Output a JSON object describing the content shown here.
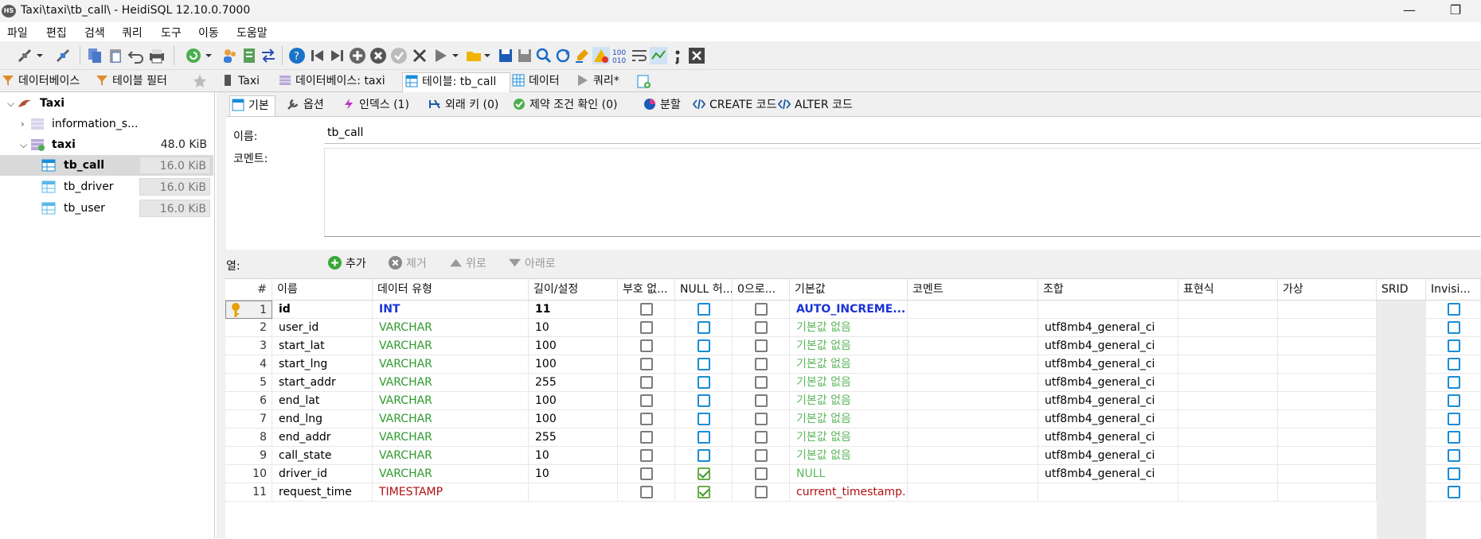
{
  "window": {
    "title": "Taxi\\taxi\\tb_call\\ - HeidiSQL 12.10.0.7000",
    "app_icon": "HS",
    "minimize": "—",
    "restore": "❐"
  },
  "menu": [
    "파일",
    "편집",
    "검색",
    "쿼리",
    "도구",
    "이동",
    "도움말"
  ],
  "main_tabs": {
    "db_tab": "데이터베이스",
    "filter_tab": "테이블 필터",
    "host": "Taxi",
    "database": "데이터베이스: taxi",
    "table": "테이블: tb_call",
    "data": "데이터",
    "query": "쿼리*"
  },
  "tree": {
    "root": "Taxi",
    "items": [
      {
        "name": "information_s...",
        "size": ""
      },
      {
        "name": "taxi",
        "size": "48.0 KiB"
      },
      {
        "name": "tb_call",
        "size": "16.0 KiB"
      },
      {
        "name": "tb_driver",
        "size": "16.0 KiB"
      },
      {
        "name": "tb_user",
        "size": "16.0 KiB"
      }
    ]
  },
  "sub_tabs": [
    "기본",
    "옵션",
    "인덱스 (1)",
    "외래 키 (0)",
    "제약 조건 확인 (0)",
    "분할",
    "CREATE 코드",
    "ALTER 코드"
  ],
  "form": {
    "name_label": "이름:",
    "name_value": "tb_call",
    "comment_label": "코멘트:"
  },
  "columns_toolbar": {
    "label": "열:",
    "add": "추가",
    "remove": "제거",
    "up": "위로",
    "down": "아래로"
  },
  "grid": {
    "headers": [
      "#",
      "이름",
      "데이터 유형",
      "길이/설정",
      "부호 없...",
      "NULL 허...",
      "0으로...",
      "기본값",
      "코멘트",
      "조합",
      "표현식",
      "가상",
      "SRID",
      "Invisi..."
    ],
    "rows": [
      {
        "n": "1",
        "name": "id",
        "type": "INT",
        "len": "11",
        "unsigned": false,
        "nullable": false,
        "zerofill": false,
        "default": "AUTO_INCREME...",
        "collation": "",
        "pk": true
      },
      {
        "n": "2",
        "name": "user_id",
        "type": "VARCHAR",
        "len": "10",
        "unsigned": false,
        "nullable": false,
        "zerofill": false,
        "default": "기본값 없음",
        "collation": "utf8mb4_general_ci"
      },
      {
        "n": "3",
        "name": "start_lat",
        "type": "VARCHAR",
        "len": "100",
        "unsigned": false,
        "nullable": false,
        "zerofill": false,
        "default": "기본값 없음",
        "collation": "utf8mb4_general_ci"
      },
      {
        "n": "4",
        "name": "start_lng",
        "type": "VARCHAR",
        "len": "100",
        "unsigned": false,
        "nullable": false,
        "zerofill": false,
        "default": "기본값 없음",
        "collation": "utf8mb4_general_ci"
      },
      {
        "n": "5",
        "name": "start_addr",
        "type": "VARCHAR",
        "len": "255",
        "unsigned": false,
        "nullable": false,
        "zerofill": false,
        "default": "기본값 없음",
        "collation": "utf8mb4_general_ci"
      },
      {
        "n": "6",
        "name": "end_lat",
        "type": "VARCHAR",
        "len": "100",
        "unsigned": false,
        "nullable": false,
        "zerofill": false,
        "default": "기본값 없음",
        "collation": "utf8mb4_general_ci"
      },
      {
        "n": "7",
        "name": "end_lng",
        "type": "VARCHAR",
        "len": "100",
        "unsigned": false,
        "nullable": false,
        "zerofill": false,
        "default": "기본값 없음",
        "collation": "utf8mb4_general_ci"
      },
      {
        "n": "8",
        "name": "end_addr",
        "type": "VARCHAR",
        "len": "255",
        "unsigned": false,
        "nullable": false,
        "zerofill": false,
        "default": "기본값 없음",
        "collation": "utf8mb4_general_ci"
      },
      {
        "n": "9",
        "name": "call_state",
        "type": "VARCHAR",
        "len": "10",
        "unsigned": false,
        "nullable": false,
        "zerofill": false,
        "default": "기본값 없음",
        "collation": "utf8mb4_general_ci"
      },
      {
        "n": "10",
        "name": "driver_id",
        "type": "VARCHAR",
        "len": "10",
        "unsigned": false,
        "nullable": true,
        "zerofill": false,
        "default": "NULL",
        "collation": "utf8mb4_general_ci"
      },
      {
        "n": "11",
        "name": "request_time",
        "type": "TIMESTAMP",
        "len": "",
        "unsigned": false,
        "nullable": true,
        "zerofill": false,
        "default": "current_timestamp...",
        "collation": ""
      }
    ]
  },
  "colors": {
    "accent_blue": "#1a8cd8",
    "type_green": "#2e9a2e",
    "type_red": "#b01010",
    "pk_key": "#e8a000"
  }
}
